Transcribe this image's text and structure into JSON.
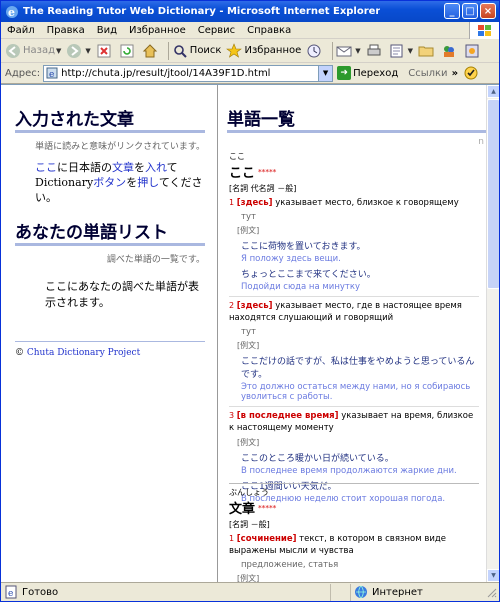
{
  "window": {
    "title": "The Reading Tutor Web Dictionary - Microsoft Internet Explorer"
  },
  "menu": [
    "Файл",
    "Правка",
    "Вид",
    "Избранное",
    "Сервис",
    "Справка"
  ],
  "toolbar": {
    "back": "Назад",
    "search": "Поиск",
    "favorites": "Избранное"
  },
  "address": {
    "label": "Адрес:",
    "url": "http://chuta.jp/result/jtool/14A39F1D.html",
    "go": "Переход",
    "links": "Ссылки"
  },
  "left": {
    "heading1": "入力された文章",
    "sub1": "単語に読みと意味がリンクされています。",
    "p_koko": "ここ",
    "p_t1": "に日本語の",
    "p_bunsho": "文章",
    "p_t2": "を",
    "p_ireru": "入れ",
    "p_t3": "て",
    "p_dict": "Dictionary",
    "p_button": "ボタン",
    "p_t4": "を",
    "p_osu": "押し",
    "p_t5": "てください。",
    "heading2": "あなたの単語リスト",
    "sub2": "調べた単語の一覧です。",
    "p2": "ここにあなたの調べた単語が表示されます。",
    "copyright_sym": "©",
    "copyright_link": "Chuta Dictionary Project"
  },
  "right": {
    "heading": "単語一覧",
    "r_mark": "n",
    "entries": [
      {
        "reading": "ここ",
        "word": "ここ",
        "stars": "*****",
        "pos": "[名詞 代名詞 －般]",
        "senses": [
          {
            "num": "1",
            "ru": "[здесь]",
            "def": "указывает место, близкое к говорящему",
            "syn": "тут",
            "ex_label": "[例文]",
            "examples": [
              {
                "ja": "ここに荷物を置いておきます。",
                "tr": "Я положу здесь вещи."
              },
              {
                "ja": "ちょっとここまで来てください。",
                "tr": "Подойди сюда на минутку"
              }
            ]
          },
          {
            "num": "2",
            "ru": "[здесь]",
            "def": "указывает место, где в настоящее время находятся слушающий и говорящий",
            "syn": "тут",
            "ex_label": "[例文]",
            "examples": [
              {
                "ja": "ここだけの話ですが、私は仕事をやめようと思っているんです。",
                "tr": "Это должно остаться между нами, но я собираюсь уволиться с работы."
              }
            ]
          },
          {
            "num": "3",
            "ru": "[в последнее время]",
            "def": "указывает на время, близкое к настоящему моменту",
            "syn": "",
            "ex_label": "[例文]",
            "examples": [
              {
                "ja": "ここのところ暖かい日が続いている。",
                "tr": "В последнее время продолжаются жаркие дни."
              },
              {
                "ja": "ここ1週間いい天気だ。",
                "tr": "В последнюю неделю стоит хорошая погода."
              }
            ]
          }
        ]
      },
      {
        "reading": "ぶんしょう",
        "word": "文章",
        "stars": "*****",
        "pos": "[名詞 －般]",
        "senses": [
          {
            "num": "1",
            "ru": "[сочинение]",
            "def": "текст, в котором в связном виде выражены мысли и чувства",
            "syn": "предложение, статья",
            "ex_label": "[例文]",
            "examples": []
          }
        ]
      }
    ]
  },
  "status": {
    "left": "Готово",
    "zone": "Интернет"
  },
  "colors": {
    "title_bar": "#0a4fd6",
    "link": "#2233cc",
    "accent_red": "#cc0000",
    "translation": "#6a7ae0"
  }
}
